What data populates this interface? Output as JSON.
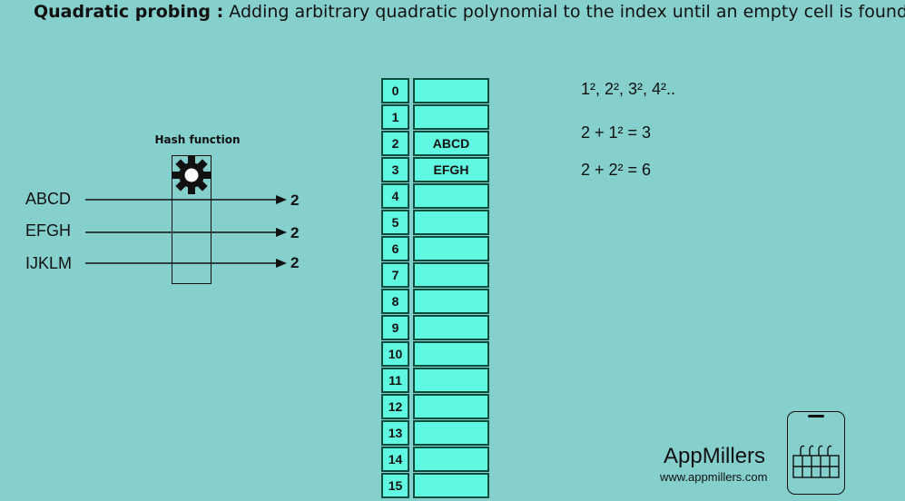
{
  "title": {
    "bold": "Quadratic probing :",
    "text": "Adding arbitrary quadratic polynomial to the index until an empty cell is found"
  },
  "hash_function": {
    "label": "Hash function",
    "icon": "gear-icon",
    "inputs": [
      {
        "key": "ABCD",
        "output": "2"
      },
      {
        "key": "EFGH",
        "output": "2"
      },
      {
        "key": "IJKLM",
        "output": "2"
      }
    ]
  },
  "table": {
    "rows": [
      {
        "index": "0",
        "value": ""
      },
      {
        "index": "1",
        "value": ""
      },
      {
        "index": "2",
        "value": "ABCD"
      },
      {
        "index": "3",
        "value": "EFGH"
      },
      {
        "index": "4",
        "value": ""
      },
      {
        "index": "5",
        "value": ""
      },
      {
        "index": "6",
        "value": ""
      },
      {
        "index": "7",
        "value": ""
      },
      {
        "index": "8",
        "value": ""
      },
      {
        "index": "9",
        "value": ""
      },
      {
        "index": "10",
        "value": ""
      },
      {
        "index": "11",
        "value": ""
      },
      {
        "index": "12",
        "value": ""
      },
      {
        "index": "13",
        "value": ""
      },
      {
        "index": "14",
        "value": ""
      },
      {
        "index": "15",
        "value": ""
      }
    ]
  },
  "formulas": {
    "sequence": "1², 2², 3², 4²..",
    "step1": "2 + 1² = 3",
    "step2": "2 + 2² = 6"
  },
  "brand": {
    "name": "AppMillers",
    "url": "www.appmillers.com",
    "logo": "factory-phone-icon"
  },
  "colors": {
    "background": "#85cfcc",
    "cell_fill": "#60f8e1",
    "cell_border": "#0a4d3c"
  }
}
